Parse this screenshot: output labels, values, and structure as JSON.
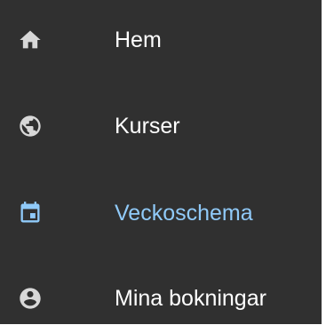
{
  "nav": {
    "items": [
      {
        "label": "Hem",
        "icon": "home-icon",
        "active": false
      },
      {
        "label": "Kurser",
        "icon": "globe-icon",
        "active": false
      },
      {
        "label": "Veckoschema",
        "icon": "calendar-icon",
        "active": true
      },
      {
        "label": "Mina bokningar",
        "icon": "account-circle-icon",
        "active": false
      }
    ],
    "colors": {
      "background": "#303030",
      "icon": "#d8d8d8",
      "text": "#ffffff",
      "active": "#90caf9"
    }
  }
}
